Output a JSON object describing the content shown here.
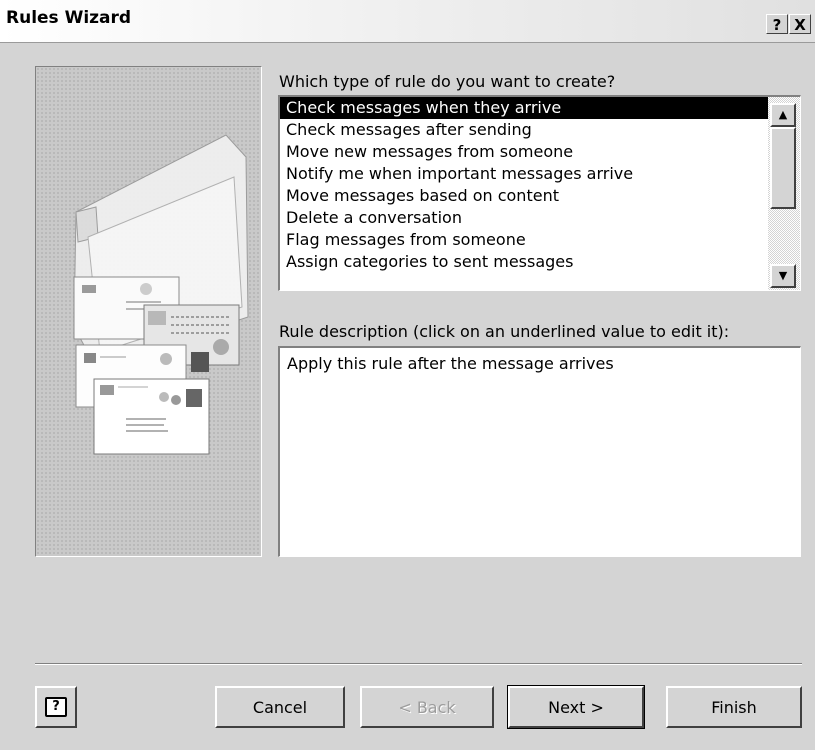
{
  "window": {
    "title": "Rules Wizard",
    "help_label": "?",
    "close_label": "X"
  },
  "rule_type": {
    "prompt": "Which type of rule do you want to create?",
    "selected_index": 0,
    "items": [
      {
        "label": "Check messages when they arrive"
      },
      {
        "label": "Check messages after sending"
      },
      {
        "label": "Move new messages from someone"
      },
      {
        "label": "Notify me when important messages arrive"
      },
      {
        "label": "Move messages based on content"
      },
      {
        "label": "Delete a conversation"
      },
      {
        "label": "Flag messages from someone"
      },
      {
        "label": "Assign categories to sent messages"
      }
    ]
  },
  "description": {
    "label": "Rule description (click on an underlined value to edit it):",
    "text": "Apply this rule after the message arrives"
  },
  "buttons": {
    "help_icon": "?",
    "cancel": "Cancel",
    "back": "< Back",
    "next": "Next >",
    "finish": "Finish"
  }
}
